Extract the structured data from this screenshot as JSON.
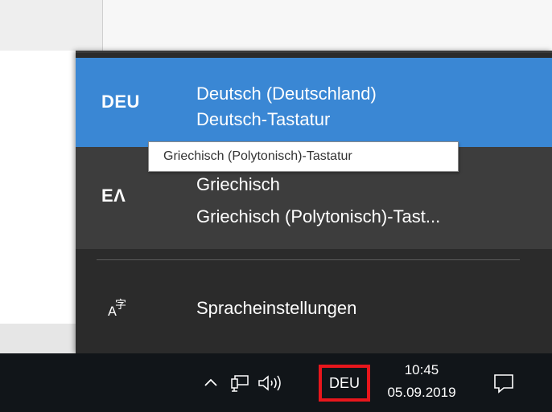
{
  "flyout": {
    "languages": [
      {
        "code": "DEU",
        "name": "Deutsch (Deutschland)",
        "keyboard": "Deutsch-Tastatur",
        "state": "selected"
      },
      {
        "code": "ΕΛ",
        "name": "Griechisch",
        "keyboard": "Griechisch (Polytonisch)-Tast...",
        "state": "hovered"
      }
    ],
    "settings_label": "Spracheinstellungen",
    "settings_icon": "language-settings-icon"
  },
  "tooltip": {
    "text": "Griechisch (Polytonisch)-Tastatur"
  },
  "taskbar": {
    "tray_icons": [
      "chevron-up-icon",
      "network-icon",
      "volume-icon"
    ],
    "language_indicator": "DEU",
    "time": "10:45",
    "date": "05.09.2019",
    "action_center_icon": "action-center-icon"
  },
  "colors": {
    "selected_bg": "#3a87d4",
    "flyout_bg": "#2b2b2b",
    "hover_bg": "#3d3d3d",
    "taskbar_bg": "#111519",
    "highlight_border": "#e8161c"
  }
}
